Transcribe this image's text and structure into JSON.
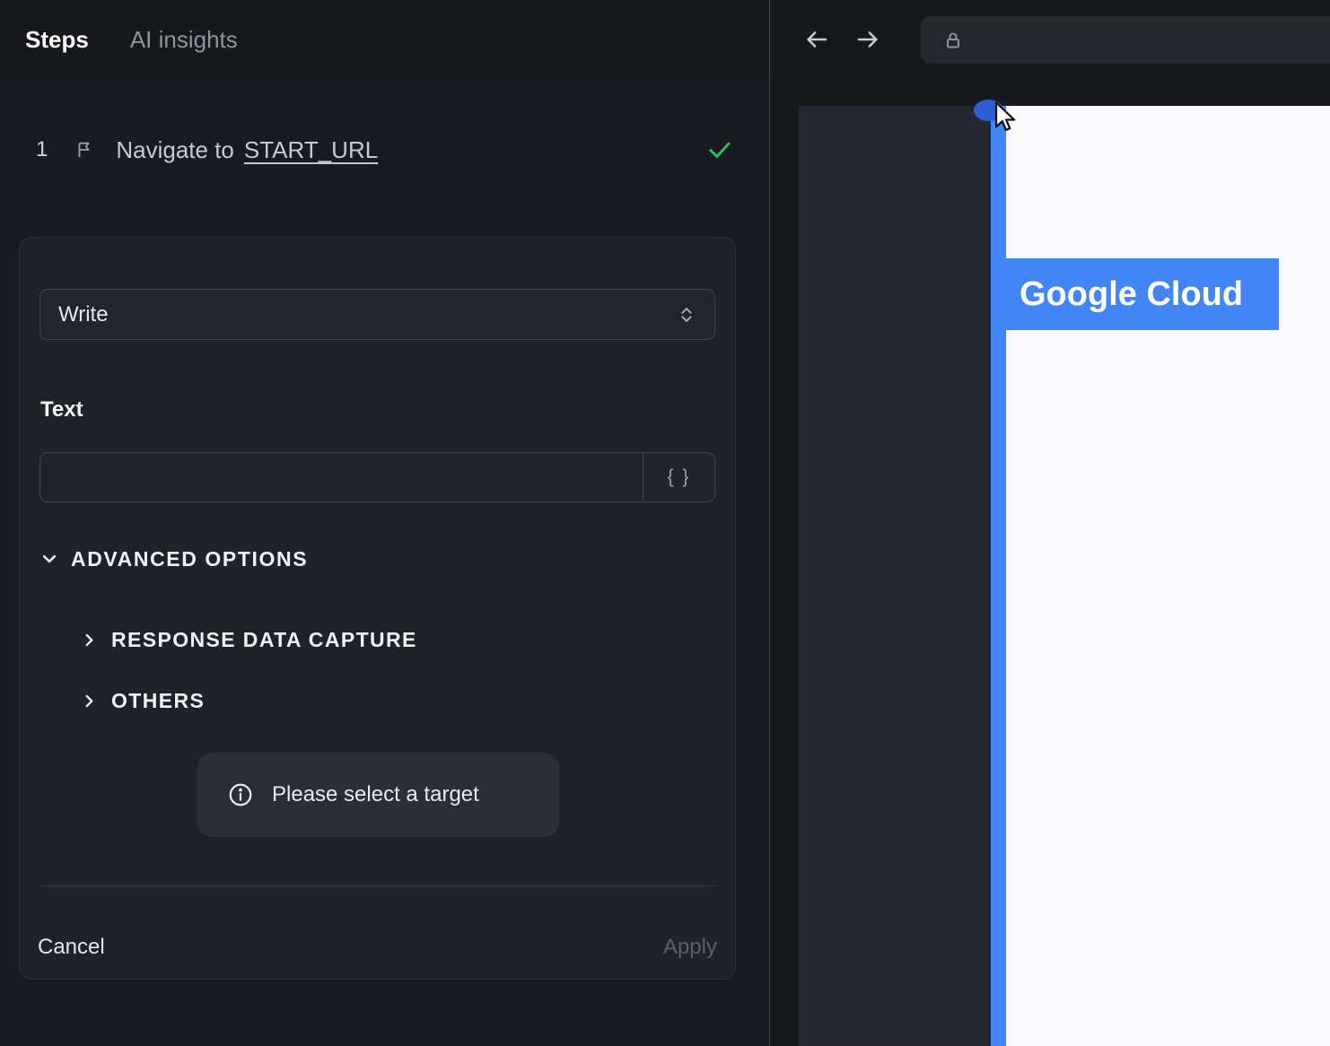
{
  "left_panel": {
    "tabs": [
      {
        "label": "Steps"
      },
      {
        "label": "AI insights"
      }
    ],
    "step": {
      "number": "1",
      "title": "Navigate to",
      "link": "START_URL"
    },
    "editor": {
      "action_value": "Write",
      "text_label": "Text",
      "text_input_value": "",
      "token_button": "{ }",
      "advanced_options": "ADVANCED OPTIONS",
      "response_capture": "RESPONSE DATA CAPTURE",
      "others": "OTHERS",
      "tooltip": "Please select a target",
      "cancel": "Cancel",
      "apply": "Apply"
    }
  },
  "browser": {
    "url_value": "",
    "highlight_label": "Google Cloud"
  },
  "colors": {
    "accent_blue": "#4285f4",
    "success_green": "#2ebd59"
  }
}
